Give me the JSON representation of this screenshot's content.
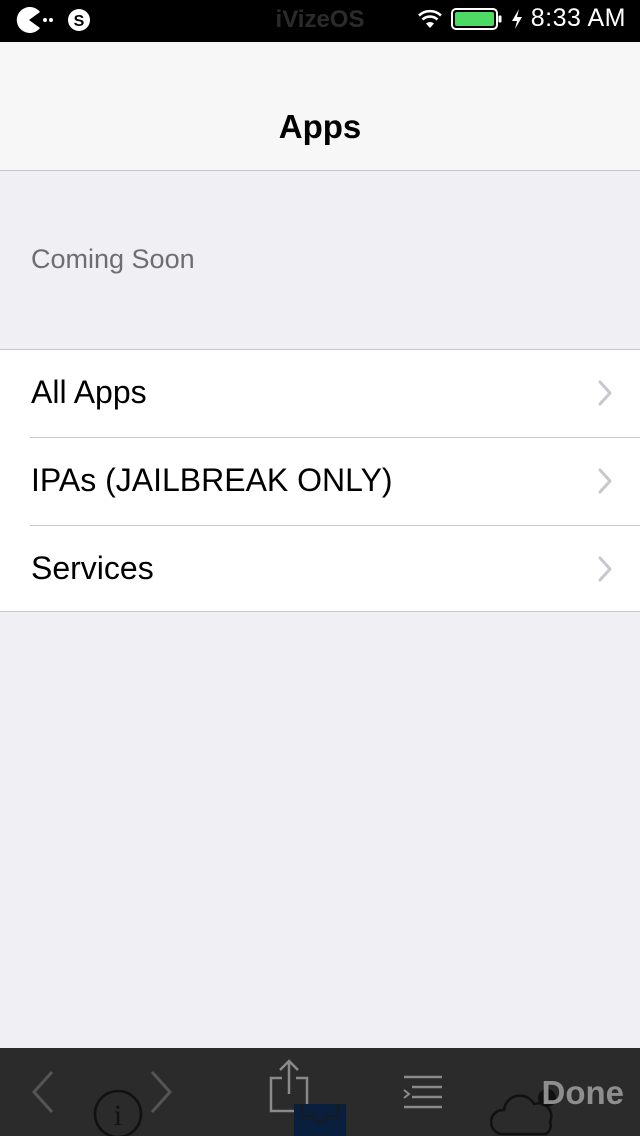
{
  "status_bar": {
    "carrier": "iVizeOS",
    "time": "8:33 AM"
  },
  "nav": {
    "title": "Apps"
  },
  "section": {
    "header": "Coming Soon"
  },
  "rows": [
    {
      "label": "All Apps",
      "icon": "chevron-right-icon"
    },
    {
      "label": "IPAs (JAILBREAK ONLY)",
      "icon": "chevron-right-icon"
    },
    {
      "label": "Services",
      "icon": "chevron-right-icon"
    }
  ],
  "toolbar": {
    "done_label": "Done",
    "icons": [
      "back-icon",
      "info-icon",
      "forward-icon",
      "share-icon",
      "inbox-icon",
      "list-icon",
      "cloud-icon"
    ]
  },
  "colors": {
    "background": "#efeff4",
    "nav_background": "#f7f7f7",
    "separator": "#c8c7cc",
    "secondary_text": "#6d6d72",
    "battery_green": "#4cd964",
    "toolbar_background": "#2b2b2b"
  }
}
